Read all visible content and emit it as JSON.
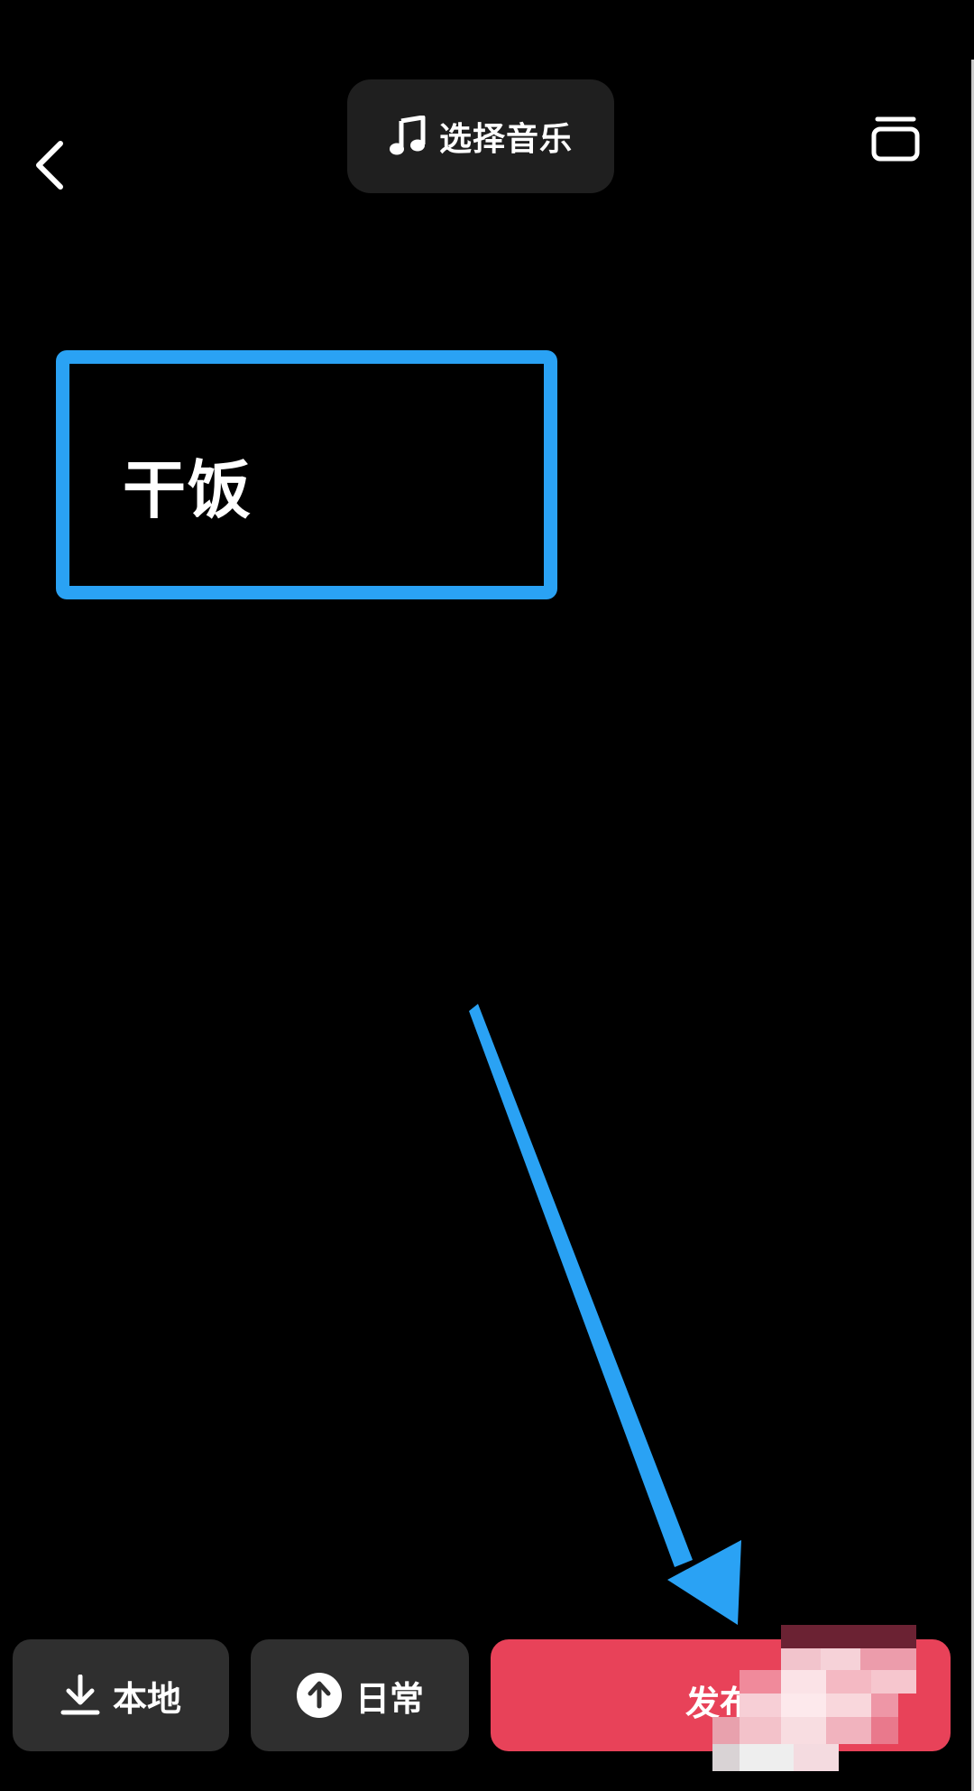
{
  "header": {
    "back_icon": "chevron-left-icon",
    "music_button": {
      "icon": "music-note-icon",
      "label": "选择音乐"
    },
    "window_icon": "stacked-window-icon"
  },
  "canvas": {
    "text_sticker": "干饭",
    "highlight_color": "#2aa2f4",
    "arrow_color": "#2aa2f4"
  },
  "bottom_bar": {
    "local": {
      "icon": "download-icon",
      "label": "本地"
    },
    "daily": {
      "icon": "upload-circle-icon",
      "label": "日常"
    },
    "publish": {
      "label": "发布",
      "color": "#e84259"
    }
  }
}
